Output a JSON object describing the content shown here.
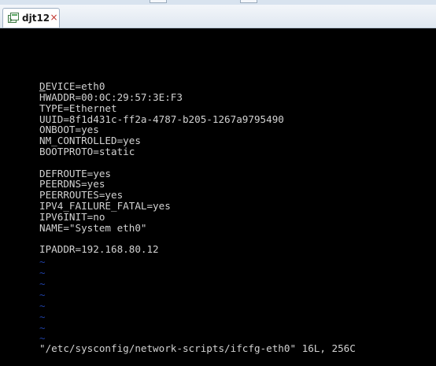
{
  "window": {
    "tab_title": "djt12",
    "tab_close_glyph": "×",
    "tab_icon": "terminal-session-icon"
  },
  "editor": {
    "first_line_cursor_char": "D",
    "first_line_rest": "EVICE=eth0",
    "lines": [
      "HWADDR=00:0C:29:57:3E:F3",
      "TYPE=Ethernet",
      "UUID=8f1d431c-ff2a-4787-b205-1267a9795490",
      "ONBOOT=yes",
      "NM_CONTROLLED=yes",
      "BOOTPROTO=static",
      "",
      "DEFROUTE=yes",
      "PEERDNS=yes",
      "PEERROUTES=yes",
      "IPV4_FAILURE_FATAL=yes",
      "IPV6INIT=no",
      "NAME=\"System eth0\"",
      "",
      "IPADDR=192.168.80.12"
    ],
    "tilde": "~",
    "status_line": "\"/etc/sysconfig/network-scripts/ifcfg-eth0\" 16L, 256C"
  },
  "colors": {
    "terminal_background": "#000000",
    "text": "#d2d2d2",
    "tilde": "#1f3fa3",
    "tab_close": "#c0302a"
  }
}
